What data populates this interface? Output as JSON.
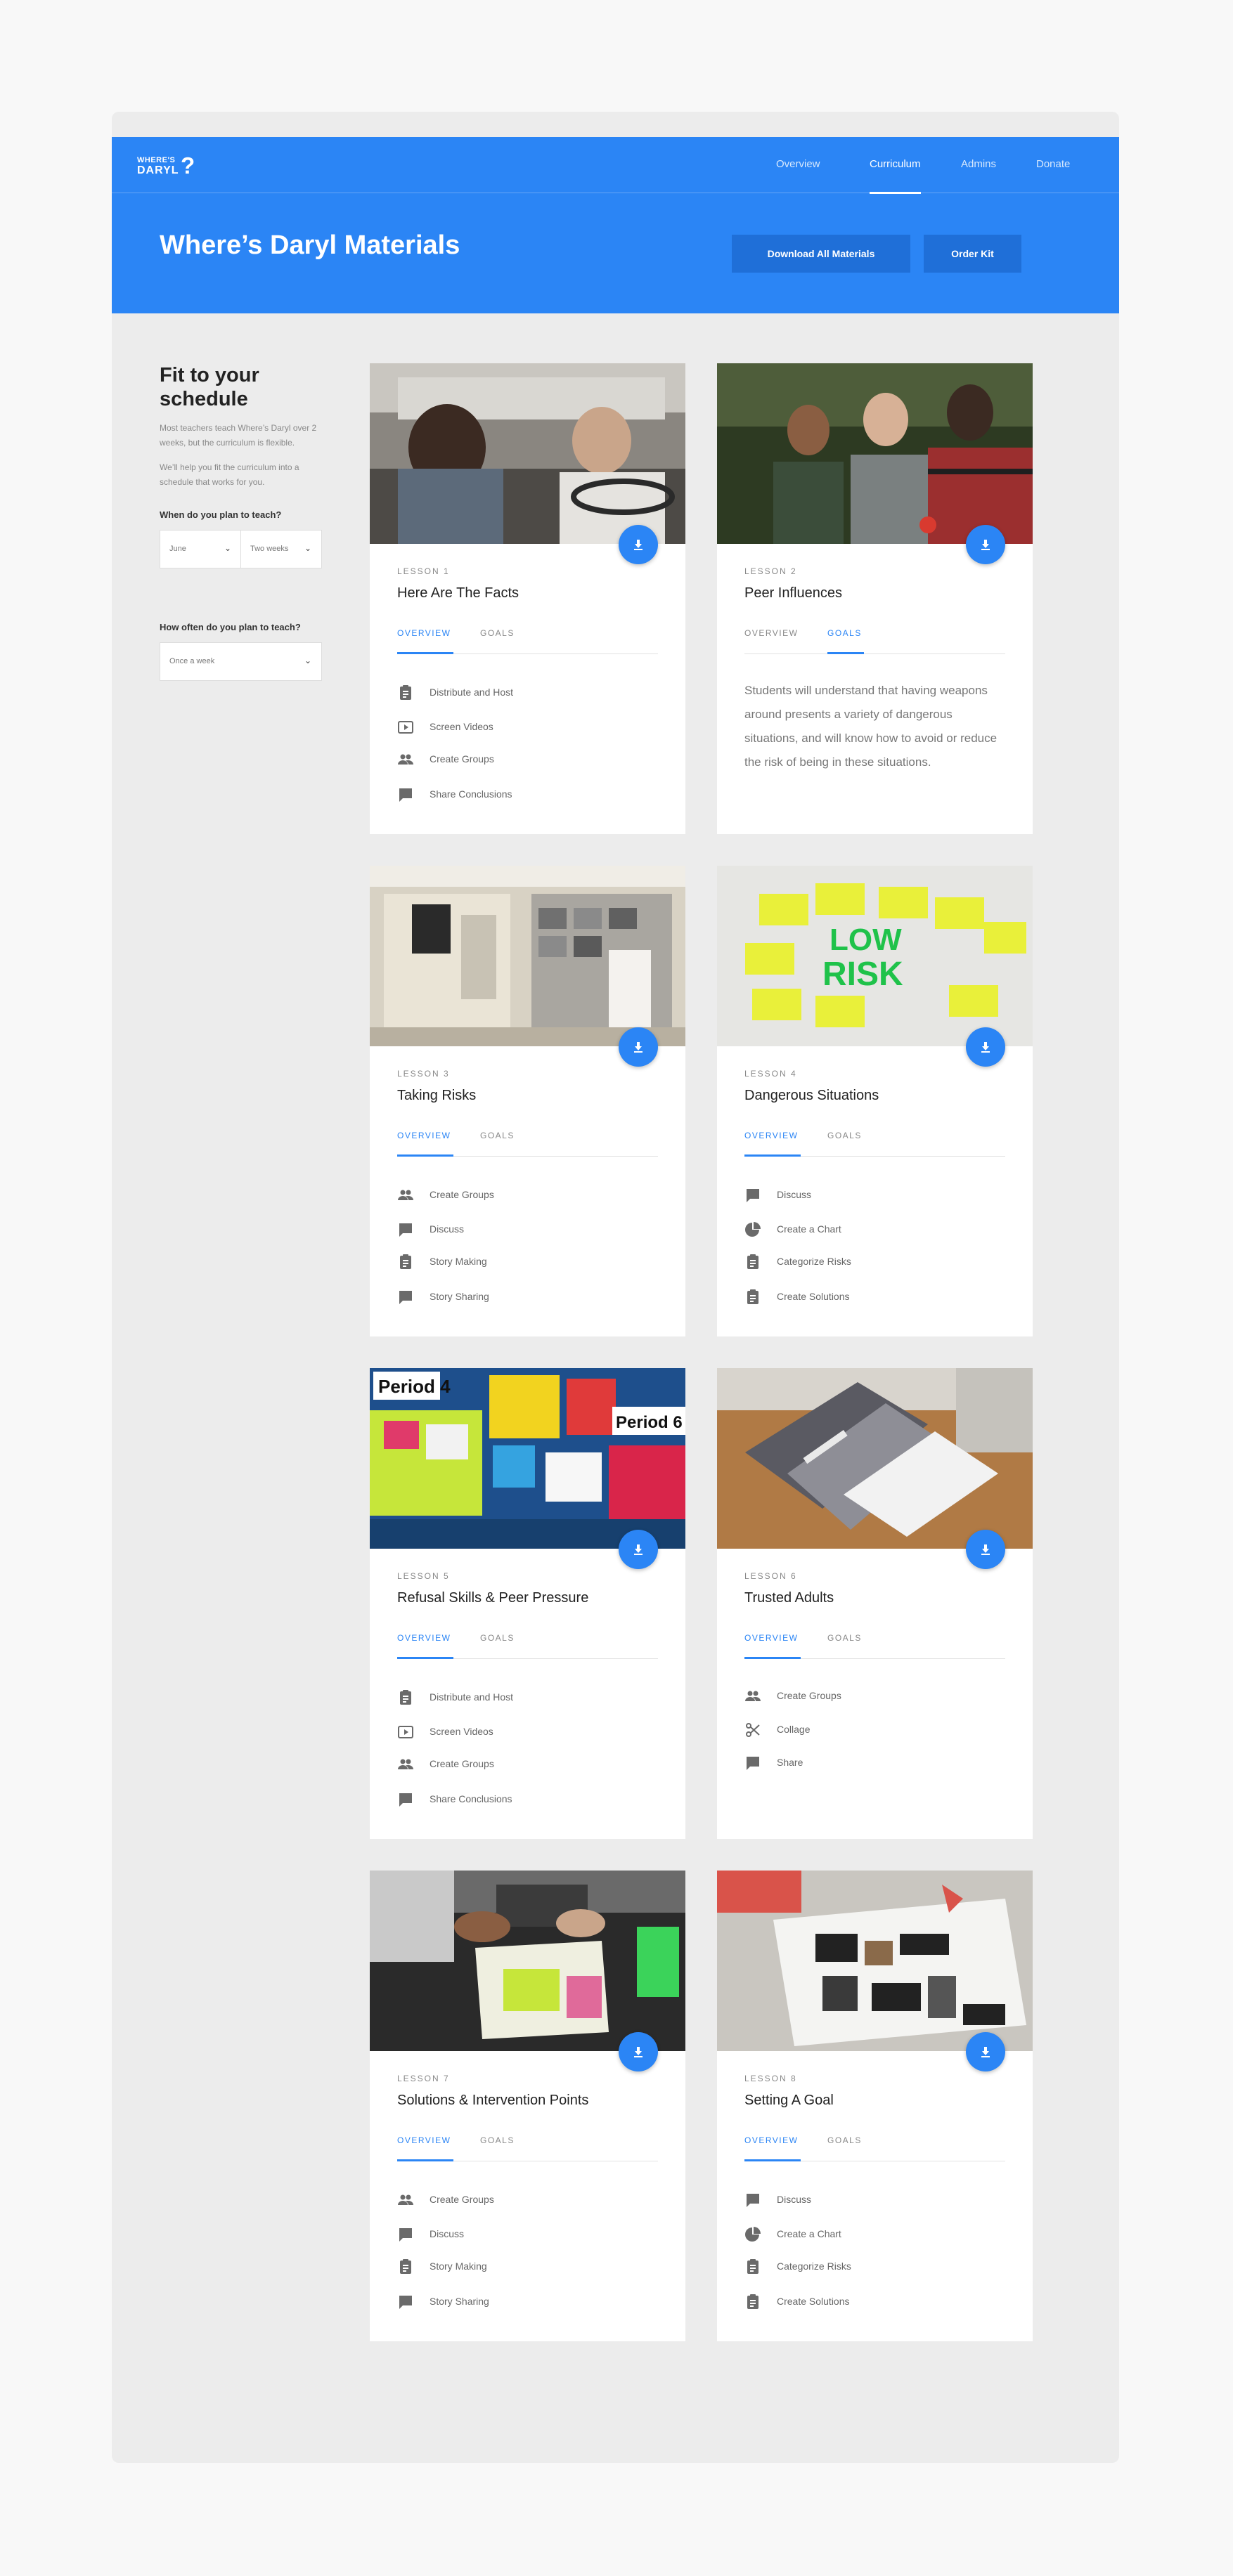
{
  "header": {
    "logo_line1": "WHERE'S",
    "logo_line2": "DARYL",
    "logo_mark": "?",
    "nav": [
      {
        "label": "Overview"
      },
      {
        "label": "Curriculum"
      },
      {
        "label": "Admins"
      },
      {
        "label": "Donate"
      }
    ],
    "active_nav": "Curriculum",
    "title": "Where’s Daryl Materials",
    "download_all_label": "Download All Materials",
    "order_kit_label": "Order Kit"
  },
  "sidebar": {
    "title": "Fit to your schedule",
    "text1": "Most teachers teach Where’s Daryl over 2 weeks, but the curriculum is flexible.",
    "text2": "We’ll help you fit the curriculum into a schedule that works for you.",
    "question1": "When do you plan to teach?",
    "month_value": "June",
    "duration_value": "Two weeks",
    "question2": "How often do you plan to teach?",
    "frequency_value": "Once a week"
  },
  "tabs": {
    "overview": "OVERVIEW",
    "goals": "GOALS"
  },
  "lessons": [
    {
      "number": "LESSON 1",
      "title": "Here Are The Facts",
      "active_tab": "overview",
      "items": [
        {
          "icon": "clipboard-icon",
          "label": "Distribute and Host"
        },
        {
          "icon": "play-video-icon",
          "label": "Screen Videos"
        },
        {
          "icon": "group-icon",
          "label": "Create Groups"
        },
        {
          "icon": "chat-icon",
          "label": "Share Conclusions"
        }
      ]
    },
    {
      "number": "LESSON 2",
      "title": "Peer Influences",
      "active_tab": "goals",
      "goals_text": "Students will understand that having weapons around presents a variety of dangerous situations, and will know how to avoid or reduce the risk of being in these situations."
    },
    {
      "number": "LESSON 3",
      "title": "Taking Risks",
      "active_tab": "overview",
      "items": [
        {
          "icon": "group-icon",
          "label": "Create Groups"
        },
        {
          "icon": "chat-icon",
          "label": "Discuss"
        },
        {
          "icon": "clipboard-icon",
          "label": "Story Making"
        },
        {
          "icon": "chat-icon",
          "label": "Story Sharing"
        }
      ]
    },
    {
      "number": "LESSON 4",
      "title": "Dangerous Situations",
      "active_tab": "overview",
      "items": [
        {
          "icon": "chat-icon",
          "label": "Discuss"
        },
        {
          "icon": "pie-chart-icon",
          "label": "Create a Chart"
        },
        {
          "icon": "clipboard-icon",
          "label": "Categorize Risks"
        },
        {
          "icon": "clipboard-icon",
          "label": "Create Solutions"
        }
      ]
    },
    {
      "number": "LESSON 5",
      "title": "Refusal Skills & Peer Pressure",
      "active_tab": "overview",
      "items": [
        {
          "icon": "clipboard-icon",
          "label": "Distribute and Host"
        },
        {
          "icon": "play-video-icon",
          "label": "Screen Videos"
        },
        {
          "icon": "group-icon",
          "label": "Create Groups"
        },
        {
          "icon": "chat-icon",
          "label": "Share Conclusions"
        }
      ]
    },
    {
      "number": "LESSON 6",
      "title": "Trusted Adults",
      "active_tab": "overview",
      "items": [
        {
          "icon": "group-icon",
          "label": "Create Groups"
        },
        {
          "icon": "scissors-icon",
          "label": "Collage"
        },
        {
          "icon": "chat-icon",
          "label": "Share"
        }
      ]
    },
    {
      "number": "LESSON 7",
      "title": "Solutions & Intervention Points",
      "active_tab": "overview",
      "items": [
        {
          "icon": "group-icon",
          "label": "Create Groups"
        },
        {
          "icon": "chat-icon",
          "label": "Discuss"
        },
        {
          "icon": "clipboard-icon",
          "label": "Story Making"
        },
        {
          "icon": "chat-icon",
          "label": "Story Sharing"
        }
      ]
    },
    {
      "number": "LESSON 8",
      "title": "Setting A Goal",
      "active_tab": "overview",
      "items": [
        {
          "icon": "chat-icon",
          "label": "Discuss"
        },
        {
          "icon": "pie-chart-icon",
          "label": "Create a Chart"
        },
        {
          "icon": "clipboard-icon",
          "label": "Categorize Risks"
        },
        {
          "icon": "clipboard-icon",
          "label": "Create Solutions"
        }
      ]
    }
  ],
  "colors": {
    "primary": "#2b85f5",
    "primary_dark": "#1f6fd8",
    "frame_bg": "#ececec",
    "page_bg": "#f8f8f8"
  }
}
